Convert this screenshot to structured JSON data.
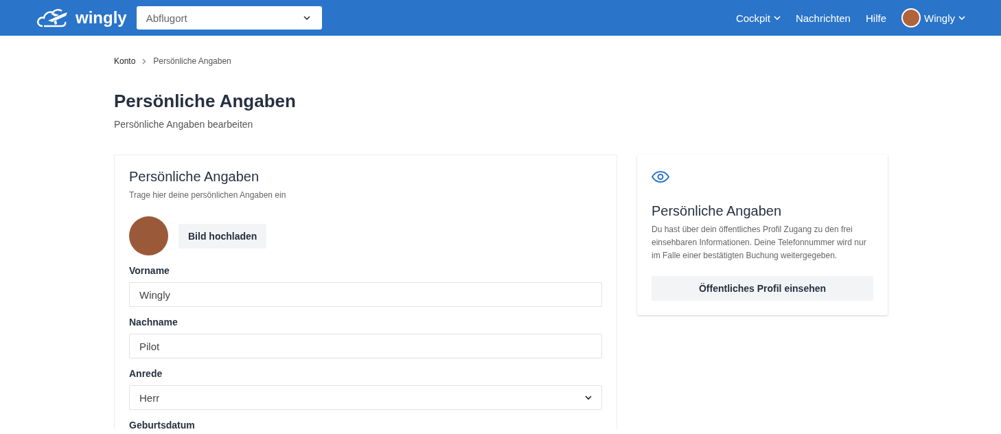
{
  "header": {
    "logo": "wingly",
    "departure": {
      "placeholder": "Abflugort"
    },
    "nav": [
      {
        "label": "Cockpit",
        "kind": "dropdown"
      },
      {
        "label": "Nachrichten",
        "kind": "link"
      },
      {
        "label": "Hilfe",
        "kind": "link"
      },
      {
        "label": "Wingly",
        "kind": "user"
      }
    ]
  },
  "breadcrumb": [
    "Konto",
    "Persönliche Angaben"
  ],
  "page_title": "Persönliche Angaben",
  "page_subtitle": "Persönliche Angaben bearbeiten",
  "form_card": {
    "title": "Persönliche Angaben",
    "subtitle": "Trage hier deine persönlichen Angaben ein",
    "upload_button": "Bild hochladen",
    "fields": [
      {
        "label": "Vorname",
        "kind": "text",
        "value": "Wingly"
      },
      {
        "label": "Nachname",
        "kind": "text",
        "value": "Pilot"
      },
      {
        "label": "Anrede",
        "kind": "select",
        "value": "Herr"
      },
      {
        "label": "Geburtsdatum",
        "kind": "label"
      }
    ]
  },
  "info_card": {
    "title": "Persönliche Angaben",
    "text": "Du hast über dein öffentliches Profil Zugang zu den frei einsehbaren Informationen. Deine Telefonnummer wird nur im Falle einer bestätigten Buchung weitergegeben.",
    "button": "Öffentliches Profil einsehen"
  }
}
